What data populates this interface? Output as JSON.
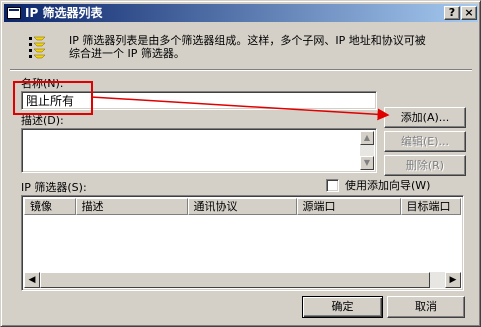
{
  "window": {
    "title": "IP 筛选器列表",
    "help_glyph": "?",
    "close_glyph": "×"
  },
  "header": {
    "description_line1": "IP 筛选器列表是由多个筛选器组成。这样，多个子网、IP 地址和协议可被",
    "description_line2": "综合进一个 IP 筛选器。"
  },
  "form": {
    "name_label": "名称(N):",
    "name_value": "阻止所有",
    "description_label": "描述(D):",
    "description_value": ""
  },
  "buttons": {
    "add": "添加(A)...",
    "edit": "编辑(E)...",
    "remove": "删除(R)",
    "ok": "确定",
    "cancel": "取消"
  },
  "filters": {
    "label": "IP 筛选器(S):",
    "use_wizard_label": "使用添加向导(W)",
    "use_wizard_checked": false,
    "columns": [
      "镜像",
      "描述",
      "通讯协议",
      "源端口",
      "目标端口"
    ],
    "rows": []
  },
  "annotation": {
    "highlight_color": "#e00000"
  }
}
